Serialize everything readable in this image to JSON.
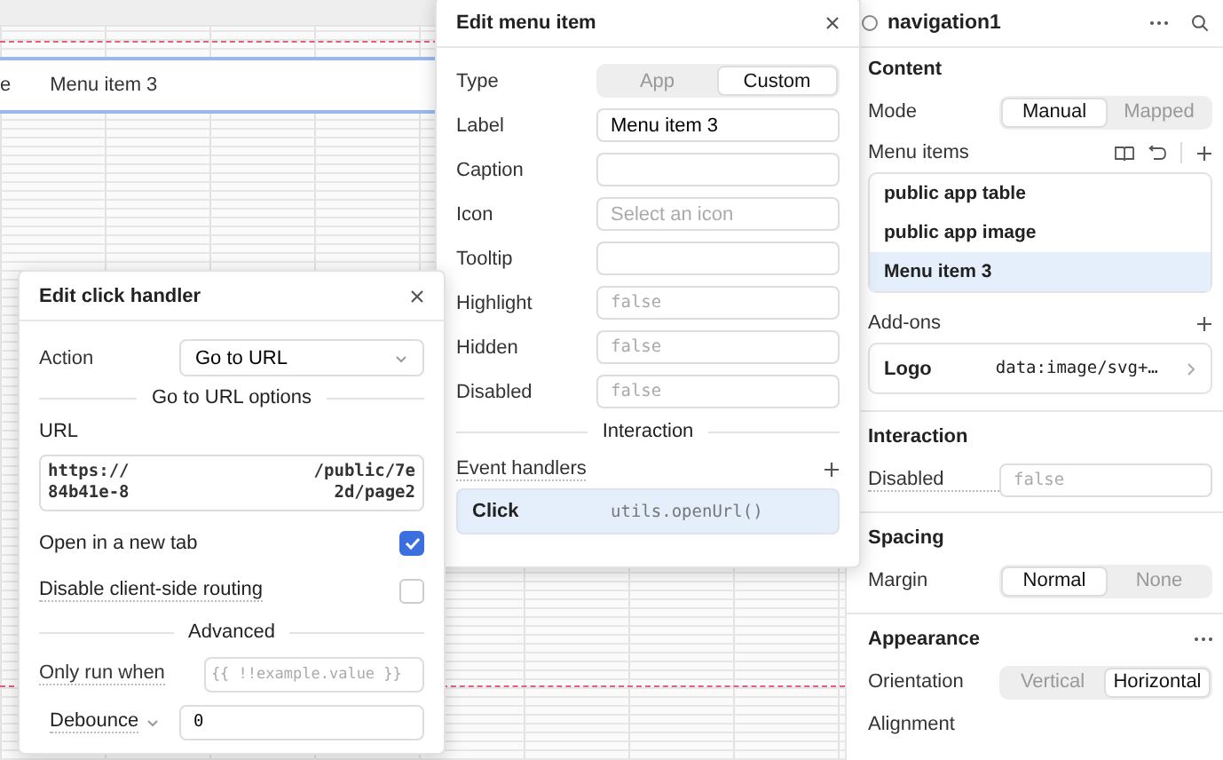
{
  "canvas": {
    "nav_items": [
      {
        "label": "e"
      },
      {
        "label": "Menu item 3"
      }
    ]
  },
  "inspector": {
    "title": "navigation1",
    "content": {
      "heading": "Content",
      "mode": {
        "label": "Mode",
        "options": [
          {
            "label": "Manual",
            "selected": true
          },
          {
            "label": "Mapped",
            "selected": false
          }
        ]
      },
      "menu_items_label": "Menu items",
      "menu_items": [
        {
          "label": "public app table",
          "selected": false
        },
        {
          "label": "public app image",
          "selected": false
        },
        {
          "label": "Menu item 3",
          "selected": true
        }
      ],
      "addons_label": "Add-ons",
      "addons": [
        {
          "label": "Logo",
          "value": "data:image/svg+…"
        }
      ]
    },
    "interaction": {
      "heading": "Interaction",
      "disabled": {
        "label": "Disabled",
        "placeholder": "false"
      }
    },
    "spacing": {
      "heading": "Spacing",
      "margin": {
        "label": "Margin",
        "options": [
          {
            "label": "Normal",
            "selected": true
          },
          {
            "label": "None",
            "selected": false
          }
        ]
      }
    },
    "appearance": {
      "heading": "Appearance",
      "orientation": {
        "label": "Orientation",
        "options": [
          {
            "label": "Vertical",
            "selected": false
          },
          {
            "label": "Horizontal",
            "selected": true
          }
        ]
      },
      "alignment": {
        "label": "Alignment"
      }
    }
  },
  "edit_menu_item": {
    "title": "Edit menu item",
    "fields": [
      {
        "label": "Type",
        "kind": "segmented",
        "options": [
          {
            "label": "App",
            "selected": false
          },
          {
            "label": "Custom",
            "selected": true
          }
        ]
      },
      {
        "label": "Label",
        "kind": "text",
        "value": "Menu item 3"
      },
      {
        "label": "Caption",
        "kind": "text"
      },
      {
        "label": "Icon",
        "kind": "text",
        "placeholder": "Select an icon"
      },
      {
        "label": "Tooltip",
        "kind": "text"
      },
      {
        "label": "Highlight",
        "kind": "code",
        "placeholder": "false"
      },
      {
        "label": "Hidden",
        "kind": "code",
        "placeholder": "false"
      },
      {
        "label": "Disabled",
        "kind": "code",
        "placeholder": "false"
      }
    ],
    "section": "Interaction",
    "event_handlers_label": "Event handlers",
    "handlers": [
      {
        "event": "Click",
        "action": "utils.openUrl()",
        "selected": true
      }
    ]
  },
  "edit_click_handler": {
    "title": "Edit click handler",
    "action": {
      "label": "Action",
      "value": "Go to URL"
    },
    "options_heading": "Go to URL options",
    "url": {
      "label": "URL",
      "lines": [
        {
          "left": "https://",
          "right": "/public/7e"
        },
        {
          "left": "84b41e-8",
          "right": "2d/page2"
        }
      ]
    },
    "checkboxes": [
      {
        "label": "Open in a new tab",
        "checked": true
      },
      {
        "label": "Disable client-side routing",
        "checked": false
      }
    ],
    "advanced_heading": "Advanced",
    "only_run_when": {
      "label": "Only run when",
      "placeholder": "{{ !!example.value }}"
    },
    "debounce": {
      "label": "Debounce",
      "value": "0"
    }
  }
}
